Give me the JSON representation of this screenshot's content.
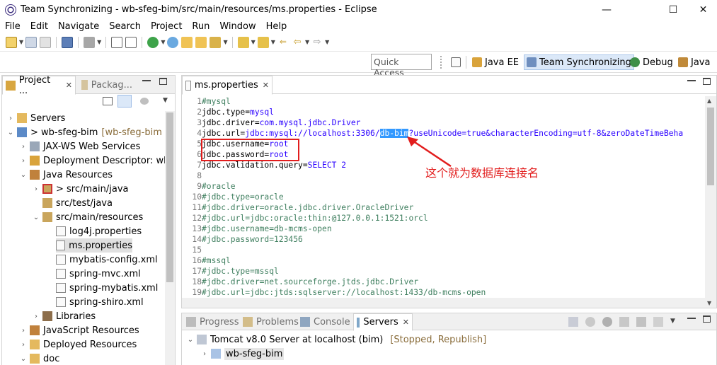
{
  "window": {
    "title": "Team Synchronizing - wb-sfeg-bim/src/main/resources/ms.properties - Eclipse",
    "minimize": "—",
    "maximize": "☐",
    "close": "✕"
  },
  "menu": [
    "File",
    "Edit",
    "Navigate",
    "Search",
    "Project",
    "Run",
    "Window",
    "Help"
  ],
  "quick_access": {
    "placeholder": "Quick Access"
  },
  "perspectives": [
    {
      "label": "Java EE",
      "active": false
    },
    {
      "label": "Team Synchronizing",
      "active": true
    },
    {
      "label": "Debug",
      "active": false
    },
    {
      "label": "Java",
      "active": false
    }
  ],
  "explorer": {
    "tab_active": "Project ...",
    "tab_inactive": "Packag...",
    "items": [
      {
        "label": "Servers",
        "deco": ""
      },
      {
        "label": "> wb-sfeg-bim",
        "deco": "[wb-sfeg-bim m"
      },
      {
        "label": "JAX-WS Web Services",
        "deco": ""
      },
      {
        "label": "Deployment Descriptor: wb-",
        "deco": ""
      },
      {
        "label": "Java Resources",
        "deco": ""
      },
      {
        "label": "> src/main/java",
        "deco": ""
      },
      {
        "label": "src/test/java",
        "deco": ""
      },
      {
        "label": "src/main/resources",
        "deco": ""
      },
      {
        "label": "log4j.properties",
        "deco": ""
      },
      {
        "label": "ms.properties",
        "deco": ""
      },
      {
        "label": "mybatis-config.xml",
        "deco": ""
      },
      {
        "label": "spring-mvc.xml",
        "deco": ""
      },
      {
        "label": "spring-mybatis.xml",
        "deco": ""
      },
      {
        "label": "spring-shiro.xml",
        "deco": ""
      },
      {
        "label": "Libraries",
        "deco": ""
      },
      {
        "label": "JavaScript Resources",
        "deco": ""
      },
      {
        "label": "Deployed Resources",
        "deco": ""
      },
      {
        "label": "doc",
        "deco": ""
      }
    ]
  },
  "editor": {
    "tab": "ms.properties",
    "lines": [
      {
        "n": "1",
        "parts": [
          {
            "t": "#mysql",
            "c": "c-comment"
          }
        ]
      },
      {
        "n": "2",
        "parts": [
          {
            "t": "jdbc.type=",
            "c": "c-key"
          },
          {
            "t": "mysql",
            "c": "c-val"
          }
        ]
      },
      {
        "n": "3",
        "parts": [
          {
            "t": "jdbc.driver=",
            "c": "c-key"
          },
          {
            "t": "com.mysql.jdbc.Driver",
            "c": "c-val"
          }
        ]
      },
      {
        "n": "4",
        "parts": [
          {
            "t": "jdbc.url=",
            "c": "c-key"
          },
          {
            "t": "jdbc:mysql://localhost:3306/",
            "c": "c-val"
          },
          {
            "t": "db-bim",
            "c": "hl"
          },
          {
            "t": "?useUnicode=true&characterEncoding=utf-8&zeroDateTimeBeha",
            "c": "c-val"
          }
        ]
      },
      {
        "n": "5",
        "parts": [
          {
            "t": "jdbc.username=",
            "c": "c-key"
          },
          {
            "t": "root",
            "c": "c-val"
          }
        ]
      },
      {
        "n": "6",
        "parts": [
          {
            "t": "jdbc.password=",
            "c": "c-key"
          },
          {
            "t": "root",
            "c": "c-val"
          }
        ]
      },
      {
        "n": "7",
        "parts": [
          {
            "t": "jdbc.validation.query=",
            "c": "c-key"
          },
          {
            "t": "SELECT 2",
            "c": "c-val"
          }
        ]
      },
      {
        "n": "8",
        "parts": []
      },
      {
        "n": "9",
        "parts": [
          {
            "t": "#oracle",
            "c": "c-comment"
          }
        ]
      },
      {
        "n": "10",
        "parts": [
          {
            "t": "#jdbc.type=oracle",
            "c": "c-comment"
          }
        ]
      },
      {
        "n": "11",
        "parts": [
          {
            "t": "#jdbc.driver=oracle.jdbc.driver.OracleDriver",
            "c": "c-comment"
          }
        ]
      },
      {
        "n": "12",
        "parts": [
          {
            "t": "#jdbc.url=jdbc:oracle:thin:@127.0.0.1:1521:orcl",
            "c": "c-comment"
          }
        ]
      },
      {
        "n": "13",
        "parts": [
          {
            "t": "#jdbc.username=db-mcms-open",
            "c": "c-comment"
          }
        ]
      },
      {
        "n": "14",
        "parts": [
          {
            "t": "#jdbc.password=123456",
            "c": "c-comment"
          }
        ]
      },
      {
        "n": "15",
        "parts": []
      },
      {
        "n": "16",
        "parts": [
          {
            "t": "#mssql",
            "c": "c-comment"
          }
        ]
      },
      {
        "n": "17",
        "parts": [
          {
            "t": "#jdbc.type=mssql",
            "c": "c-comment"
          }
        ]
      },
      {
        "n": "18",
        "parts": [
          {
            "t": "#jdbc.driver=net.sourceforge.jtds.jdbc.Driver",
            "c": "c-comment"
          }
        ]
      },
      {
        "n": "19",
        "parts": [
          {
            "t": "#jdbc.url=jdbc:jtds:sqlserver://localhost:1433/db-mcms-open",
            "c": "c-comment"
          }
        ]
      }
    ],
    "annotation": "这个就为数据库连接名"
  },
  "bottom": {
    "tabs": [
      "Progress",
      "Problems",
      "Console",
      "Servers"
    ],
    "active_tab": "Servers",
    "server": {
      "label": "Tomcat v8.0 Server at localhost  (bim)",
      "status": "[Stopped, Republish]"
    },
    "module": "wb-sfeg-bim"
  },
  "colors": {
    "accent": "#3399ff",
    "annotation": "#e21d1d",
    "comment": "#3f7f5f",
    "value": "#2a00ff"
  }
}
